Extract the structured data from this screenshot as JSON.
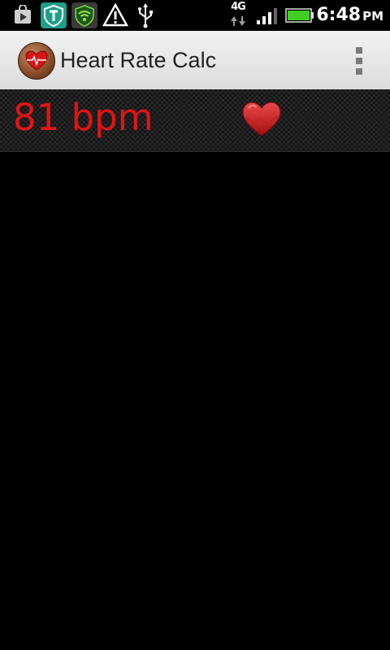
{
  "status_bar": {
    "network": "4G",
    "time": "6:48",
    "ampm": "PM",
    "icons": [
      "play-store-icon",
      "shield-t-icon",
      "wifi-lock-icon",
      "warning-icon",
      "usb-icon",
      "data-arrows-icon",
      "signal-icon",
      "battery-icon"
    ]
  },
  "app_bar": {
    "title": "Heart Rate Calc",
    "app_icon": "heart-rate-app-icon",
    "menu_icon": "overflow-menu-icon"
  },
  "heart_rate": {
    "display": "81 bpm",
    "icon": "heart-icon",
    "color": "#e11414"
  }
}
